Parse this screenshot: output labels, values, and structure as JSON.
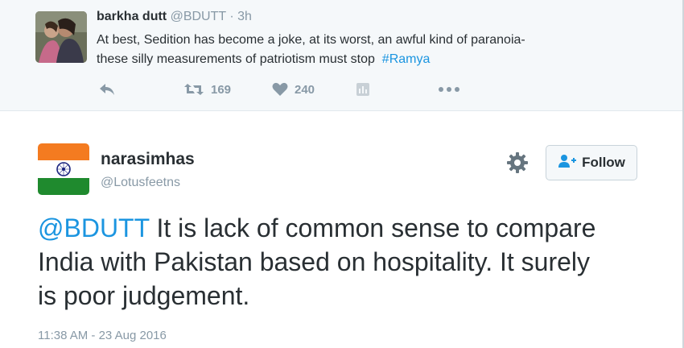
{
  "parent_tweet": {
    "name": "barkha dutt",
    "handle": "@BDUTT",
    "separator": "·",
    "time": "3h",
    "text_line1": "At best, Sedition has become a joke, at its worst, an awful kind of paranoia-",
    "text_line2": "these silly measurements of patriotism must stop",
    "hashtag": "#Ramya",
    "retweet_count": "169",
    "like_count": "240"
  },
  "main_tweet": {
    "name": "narasimhas",
    "handle": "@Lotusfeetns",
    "follow_label": "Follow",
    "mention": "@BDUTT",
    "text": " It is lack of common sense to compare India with Pakistan based on hospitality. It surely is poor judgement.",
    "timestamp": "11:38 AM - 23 Aug 2016"
  },
  "colors": {
    "link_blue": "#1b95e0",
    "muted_gray": "#8899a6",
    "flag_saffron": "#f47b20",
    "flag_green": "#1f8a2e",
    "chakra_navy": "#1a237e"
  }
}
